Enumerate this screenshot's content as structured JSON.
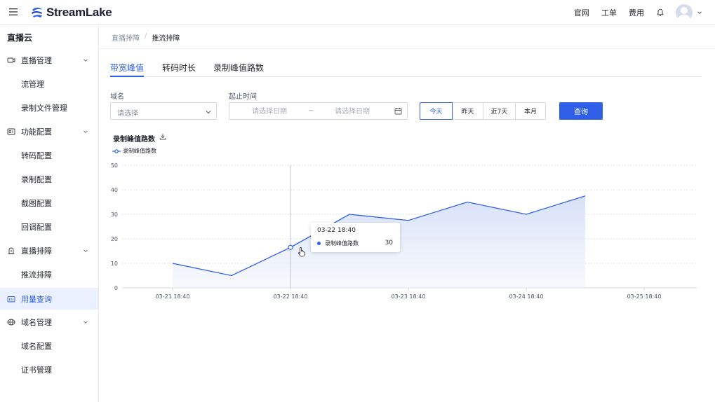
{
  "header": {
    "brand": "StreamLake",
    "links": [
      "官网",
      "工单",
      "费用"
    ],
    "icons": {
      "menu": "menu-icon",
      "notifications": "bell-icon",
      "avatar": "user-avatar",
      "account_menu": "chevron-down-icon"
    }
  },
  "sidebar": {
    "title": "直播云",
    "groups": [
      {
        "label": "直播管理",
        "icon": "live-stream-icon",
        "items": [
          "流管理",
          "录制文件管理"
        ]
      },
      {
        "label": "功能配置",
        "icon": "config-icon",
        "items": [
          "转码配置",
          "录制配置",
          "截图配置",
          "回调配置"
        ]
      },
      {
        "label": "直播排障",
        "icon": "troubleshoot-icon",
        "items": [
          "推流排障"
        ]
      },
      {
        "label": "用量查询",
        "icon": "usage-icon",
        "active": true,
        "items": []
      },
      {
        "label": "域名管理",
        "icon": "domain-icon",
        "items": [
          "域名配置",
          "证书管理"
        ]
      }
    ]
  },
  "breadcrumb": [
    "直播排障",
    "推流排障"
  ],
  "tabs": [
    {
      "label": "带宽峰值",
      "active": true
    },
    {
      "label": "转码时长",
      "active": false
    },
    {
      "label": "录制峰值路数",
      "active": false
    }
  ],
  "filters": {
    "domain": {
      "label": "域名",
      "placeholder": "请选择"
    },
    "date_range": {
      "label": "起止时间",
      "start_placeholder": "请选择日期",
      "end_placeholder": "请选择日期",
      "separator": "~"
    },
    "quick_ranges": [
      {
        "label": "今天",
        "active": true
      },
      {
        "label": "昨天",
        "active": false
      },
      {
        "label": "近7天",
        "active": false
      },
      {
        "label": "本月",
        "active": false
      }
    ],
    "query_label": "查询"
  },
  "colors": {
    "accent": "#2f5fe6",
    "area_fill": "#dfe6f8",
    "grid": "#d9d9d9"
  },
  "chart_data": {
    "type": "area",
    "title": "录制峰值路数",
    "x": [
      "03-21 18:40",
      "03-22 06:40",
      "03-22 18:40",
      "03-23 06:40",
      "03-23 18:40",
      "03-24 06:40",
      "03-24 18:40",
      "03-25 06:40",
      "03-25 18:40"
    ],
    "series": [
      {
        "name": "录制峰值路数",
        "values": [
          10,
          5,
          16.5,
          30,
          27.5,
          35,
          30,
          37.5
        ]
      }
    ],
    "x_ticks": [
      "03-21 18:40",
      "03-22 18:40",
      "03-23 18:40",
      "03-24 18:40",
      "03-25 18:40"
    ],
    "y_ticks": [
      0,
      10,
      20,
      30,
      40,
      50
    ],
    "ylim": [
      0,
      50
    ],
    "grid": true,
    "legend_position": "top-left",
    "tooltip": {
      "time": "03-22 18:40",
      "series": "录制峰值路数",
      "value": "30"
    }
  }
}
